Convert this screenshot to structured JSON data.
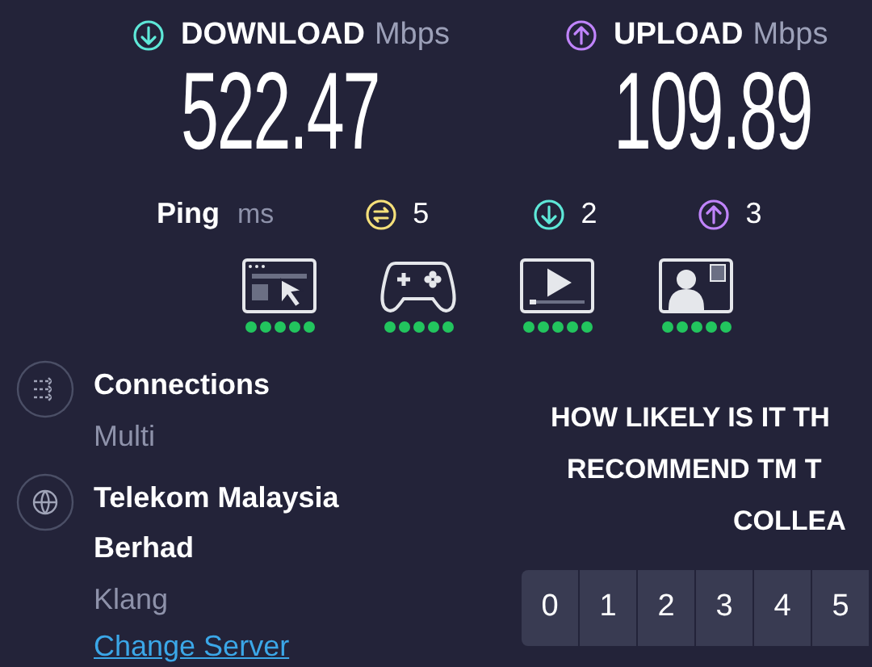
{
  "download": {
    "label": "DOWNLOAD",
    "unit": "Mbps",
    "value": "522.47"
  },
  "upload": {
    "label": "UPLOAD",
    "unit": "Mbps",
    "value": "109.89"
  },
  "ping": {
    "label": "Ping",
    "unit": "ms",
    "readings": [
      {
        "kind": "idle",
        "value": "5"
      },
      {
        "kind": "download",
        "value": "2"
      },
      {
        "kind": "upload",
        "value": "3"
      }
    ]
  },
  "activities": [
    {
      "kind": "browsing",
      "stars": 5
    },
    {
      "kind": "gaming",
      "stars": 5
    },
    {
      "kind": "streaming",
      "stars": 5
    },
    {
      "kind": "video-call",
      "stars": 5
    }
  ],
  "details": [
    {
      "kind": "connections",
      "title": "Connections",
      "value": "Multi"
    },
    {
      "kind": "server",
      "title": "Telekom Malaysia Berhad",
      "value": "Klang",
      "link": "Change Server"
    }
  ],
  "survey": {
    "question_lines": [
      "HOW LIKELY IS IT TH",
      "RECOMMEND TM T",
      "COLLEA"
    ],
    "options": [
      "0",
      "1",
      "2",
      "3",
      "4",
      "5"
    ]
  }
}
